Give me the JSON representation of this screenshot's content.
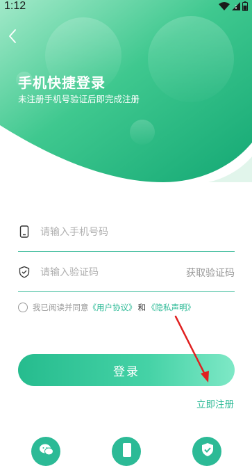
{
  "status_bar": {
    "time": "1:12"
  },
  "header": {
    "title": "手机快捷登录",
    "subtitle": "未注册手机号验证后即完成注册"
  },
  "form": {
    "phone_placeholder": "请输入手机号码",
    "code_placeholder": "请输入验证码",
    "get_code_label": "获取验证码"
  },
  "agreement": {
    "prefix": "我已阅读并同意",
    "user_agreement": "《用户协议》",
    "and": "和",
    "privacy_statement": "《隐私声明》"
  },
  "login_button": "登录",
  "register_link": "立即注册",
  "colors": {
    "accent": "#2cba96",
    "header_dark": "#1db07e",
    "header_light": "#9fe6c5",
    "annotation_arrow": "#e02020"
  },
  "icons": {
    "back": "chevron-left-icon",
    "phone": "phone-icon",
    "shield": "shield-icon",
    "social": [
      "wechat-icon",
      "mobile-icon",
      "shield-check-icon"
    ]
  }
}
